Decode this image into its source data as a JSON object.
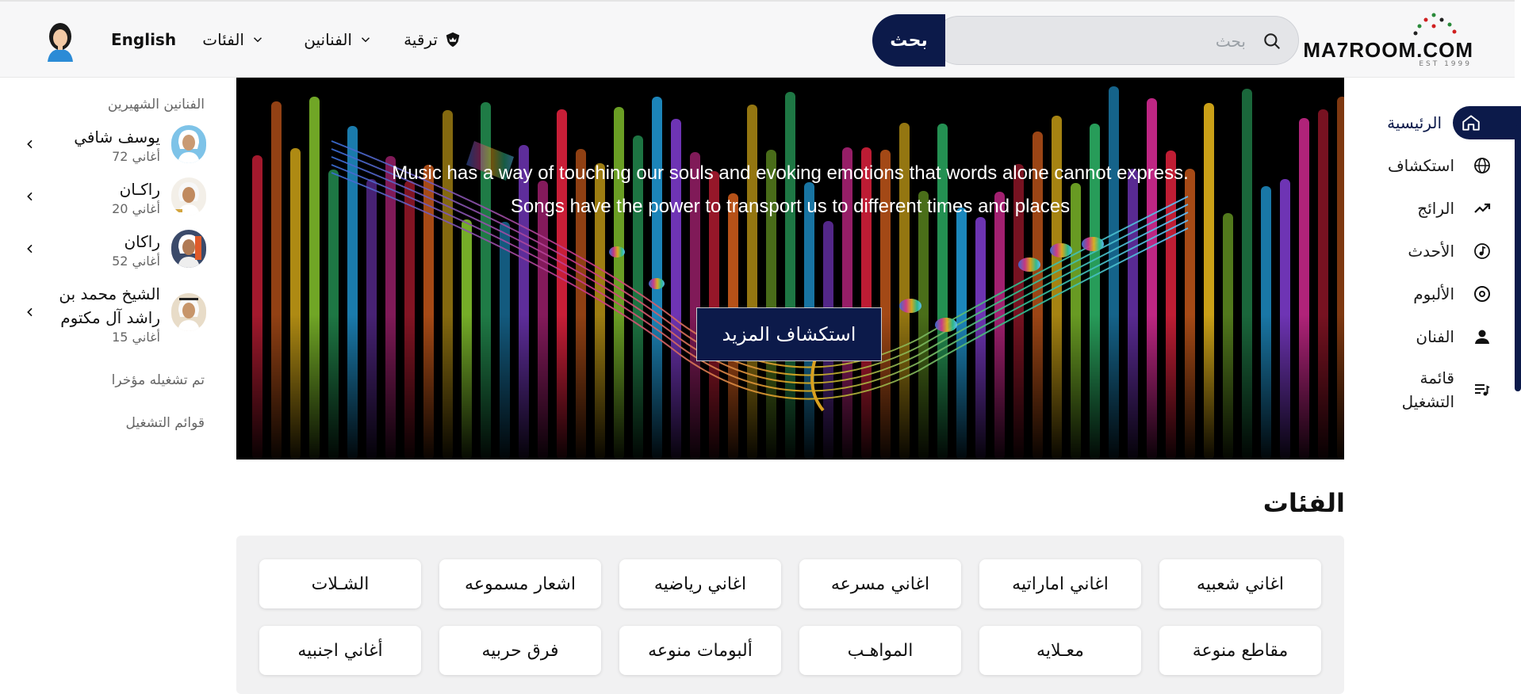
{
  "header": {
    "logo_text": "MA7ROOM.COM",
    "logo_est": "EST 1999",
    "search_placeholder": "بحث",
    "search_button": "بحث",
    "nav_upgrade": "ترقية",
    "nav_artists": "الفنانين",
    "nav_categories": "الفئات",
    "nav_language": "English"
  },
  "sidebar_right": {
    "items": [
      {
        "label": "الرئيسية",
        "icon": "home-icon",
        "active": true
      },
      {
        "label": "استكشاف",
        "icon": "globe-icon"
      },
      {
        "label": "الرائج",
        "icon": "trending-icon"
      },
      {
        "label": "الأحدث",
        "icon": "new-music-icon"
      },
      {
        "label": "الألبوم",
        "icon": "album-icon"
      },
      {
        "label": "الفنان",
        "icon": "person-icon"
      },
      {
        "label": "قائمة التشغيل",
        "icon": "playlist-icon"
      }
    ]
  },
  "sidebar_left": {
    "popular_title": "الفنانين الشهيرين",
    "artists": [
      {
        "name": "يوسف شافي",
        "count": "72 أغاني"
      },
      {
        "name": "راكـان",
        "count": "20 أغاني"
      },
      {
        "name": "راكان",
        "count": "52 أغاني"
      },
      {
        "name": "الشيخ محمد بن راشد آل مكتوم",
        "count": "15 أغاني"
      }
    ],
    "recently_played": "تم تشغيله مؤخرا",
    "playlists": "قوائم التشغيل"
  },
  "hero": {
    "line1": "Music has a way of touching our souls and evoking emotions that words alone cannot express.",
    "line2": "Songs have the power to transport us to different times and places",
    "button": "استكشاف المزيد"
  },
  "categories": {
    "title": "الفئات",
    "row1": [
      "اغاني شعبيه",
      "اغاني اماراتيه",
      "اغاني مسرعه",
      "اغاني رياضيه",
      "اشعار مسموعه",
      "الشـلات"
    ],
    "row2": [
      "مقاطع منوعة",
      "معـلايه",
      "المواهـب",
      "ألبومات منوعه",
      "فرق حربيه",
      "أغاني اجنبيه"
    ]
  },
  "colors": {
    "brand_navy": "#0c1a4a",
    "hero_bg": "#000000"
  }
}
